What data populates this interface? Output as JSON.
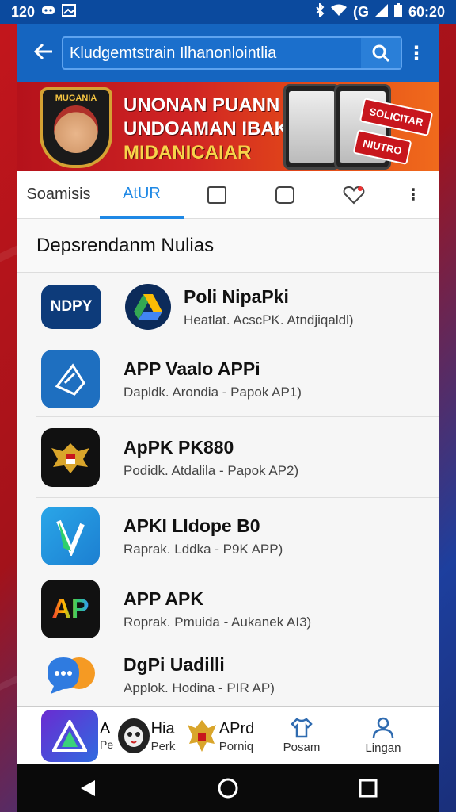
{
  "status_bar": {
    "time_left": "120",
    "time_right": "60:20",
    "battery_label": "(G",
    "icons": [
      "discord-icon",
      "image-icon",
      "bluetooth-icon",
      "wifi-icon",
      "signal-icon",
      "battery-icon"
    ]
  },
  "app_bar": {
    "search_value": "Kludgemtstrain Ilhanonlointlia",
    "icons": {
      "back": "arrow-left-icon",
      "search": "search-icon",
      "overflow": "more-vert-icon"
    }
  },
  "banner": {
    "badge_text": "MUGANIA",
    "line1": "UNONAN PUANN",
    "line2": "UNDOAMAN IBAKAS",
    "line3": "MIDANICAIAR",
    "tag1": "SOLICITAR",
    "tag2": "NIUTRO",
    "colors": {
      "red": "#c4161c",
      "gold": "#f7d34a"
    }
  },
  "tabs": {
    "items": [
      {
        "label": "Soamisis",
        "active": false
      },
      {
        "label": "AtUR",
        "active": true
      }
    ],
    "icon_tabs": [
      "square-icon",
      "tablet-icon",
      "heart-shield-icon",
      "more-vert-icon"
    ]
  },
  "list": {
    "section_title": "Depsrendanm Nulias",
    "rows": [
      {
        "name": "Poli NipaPki",
        "sub": "Heatlat.  AcscPK.  Atndjiqaldl)",
        "icon_text": "NDPY",
        "icon_color": "#0d3b7a"
      },
      {
        "name": "APP Vaalo APPi",
        "sub": "Dapldk.  Arondia  -  Papok AP1)",
        "icon_text": "",
        "icon_color": "#1e6fc0"
      },
      {
        "name": "ApPK PK880",
        "sub": "Podidk.  Atdalila  -  Papok AP2)",
        "icon_text": "",
        "icon_color": "#111111"
      },
      {
        "name": "APKI Lldope B0",
        "sub": "Raprak.  Lddka  -  P9K APP)",
        "icon_text": "",
        "icon_color": "#2aa6e8"
      },
      {
        "name": "APP APK",
        "sub": "Roprak.  Pmuida  -  Aukanek AI3)",
        "icon_text": "AP",
        "icon_color": "#111111"
      },
      {
        "name": "DgPi Uadilli",
        "sub": "Applok.  Hodina  -  PIR AP)",
        "icon_text": "",
        "icon_color": "#f6f6f6"
      }
    ],
    "extra_icon": "triangle-app-icon"
  },
  "bottom_nav": {
    "partial_name": "A",
    "partial_sub": "Pe",
    "items": [
      {
        "label": "Hia",
        "sub": "Perk",
        "icon": "mask-icon"
      },
      {
        "label": "APrd",
        "sub": "Porniq",
        "icon": "garuda-icon"
      },
      {
        "label": "Posam",
        "icon": "shirt-icon"
      },
      {
        "label": "Lingan",
        "icon": "person-icon"
      }
    ]
  },
  "system_nav": {
    "icons": [
      "back-triangle-icon",
      "home-circle-icon",
      "recents-square-icon"
    ]
  }
}
